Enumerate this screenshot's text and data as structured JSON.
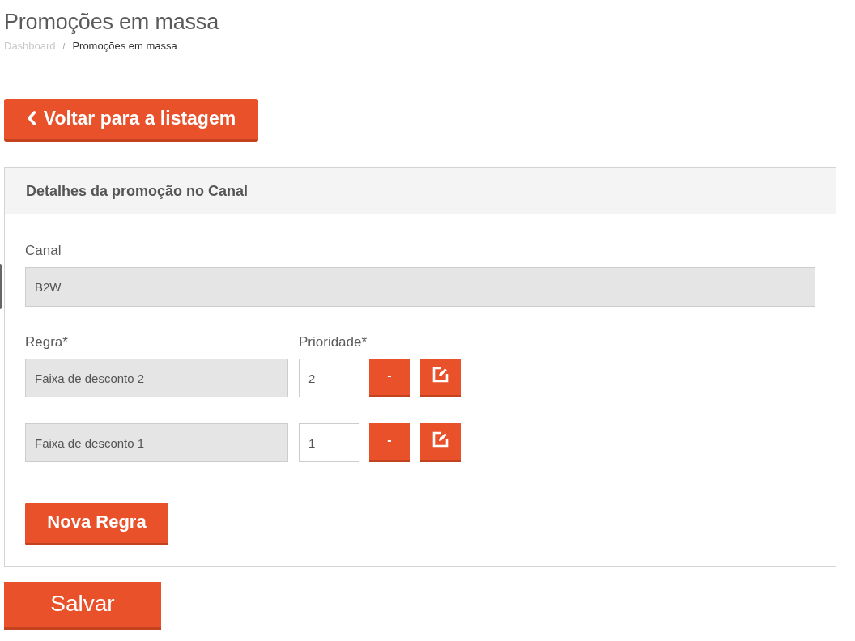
{
  "page": {
    "title": "Promoções em massa"
  },
  "breadcrumb": {
    "separator": "/",
    "items": [
      {
        "label": "Dashboard",
        "current": false
      },
      {
        "label": "Promoções em massa",
        "current": true
      }
    ]
  },
  "back_button": {
    "label": "Voltar para a listagem"
  },
  "panel": {
    "title": "Detalhes da promoção no Canal",
    "channel": {
      "label": "Canal",
      "value": "B2W",
      "disabled": true
    },
    "rule_label": "Regra*",
    "priority_label": "Prioridade*",
    "rules": [
      {
        "rule": {
          "value": "Faixa de desconto 2",
          "disabled": true
        },
        "priority": {
          "value": "2",
          "disabled": false
        },
        "remove_label": "-"
      },
      {
        "rule": {
          "value": "Faixa de desconto 1",
          "disabled": true
        },
        "priority": {
          "value": "1",
          "disabled": false
        },
        "remove_label": "-"
      }
    ],
    "new_rule_button": {
      "label": "Nova Regra"
    }
  },
  "save_button": {
    "label": "Salvar"
  }
}
